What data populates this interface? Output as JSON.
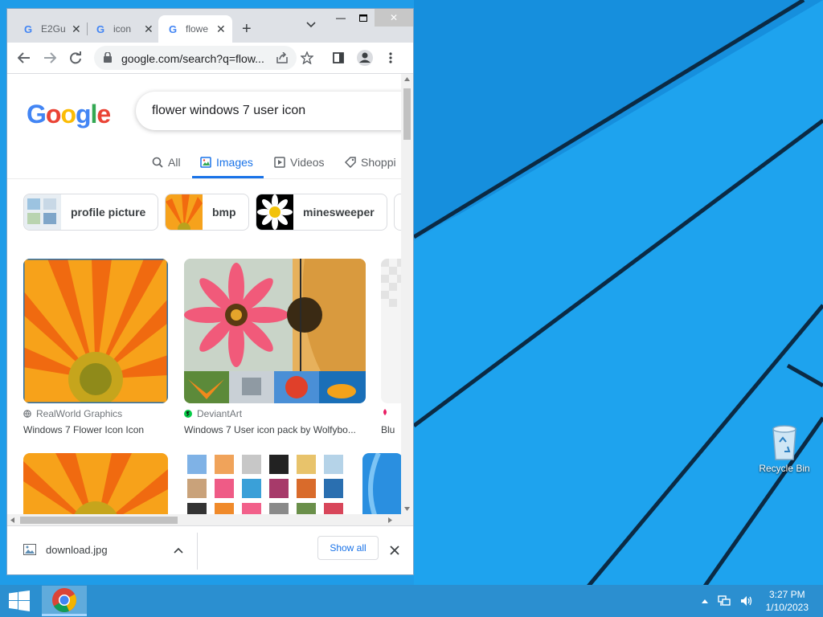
{
  "desktop": {
    "recycle_bin_label": "Recycle Bin"
  },
  "taskbar": {
    "time": "3:27 PM",
    "date": "1/10/2023"
  },
  "browser": {
    "tabs": [
      {
        "title": "E2Gu",
        "active": false
      },
      {
        "title": "icon",
        "active": false
      },
      {
        "title": "flowe",
        "active": true
      }
    ],
    "address": "google.com/search?q=flow..."
  },
  "google": {
    "logo": "Google",
    "query": "flower windows 7 user icon",
    "tabs": [
      {
        "label": "All",
        "active": false
      },
      {
        "label": "Images",
        "active": true
      },
      {
        "label": "Videos",
        "active": false
      },
      {
        "label": "Shoppi",
        "active": false
      }
    ],
    "chips": [
      {
        "label": "profile picture"
      },
      {
        "label": "bmp"
      },
      {
        "label": "minesweeper"
      }
    ],
    "results": [
      {
        "source": "RealWorld Graphics",
        "title": "Windows 7 Flower Icon Icon"
      },
      {
        "source": "DeviantArt",
        "title": "Windows 7 User icon pack by Wolfybo..."
      },
      {
        "source": "",
        "title": "Blu"
      }
    ]
  },
  "downloads": {
    "file": "download.jpg",
    "show_all": "Show all"
  },
  "colors": {
    "desktop": "#1e9be6",
    "accent": "#1a73e8"
  }
}
